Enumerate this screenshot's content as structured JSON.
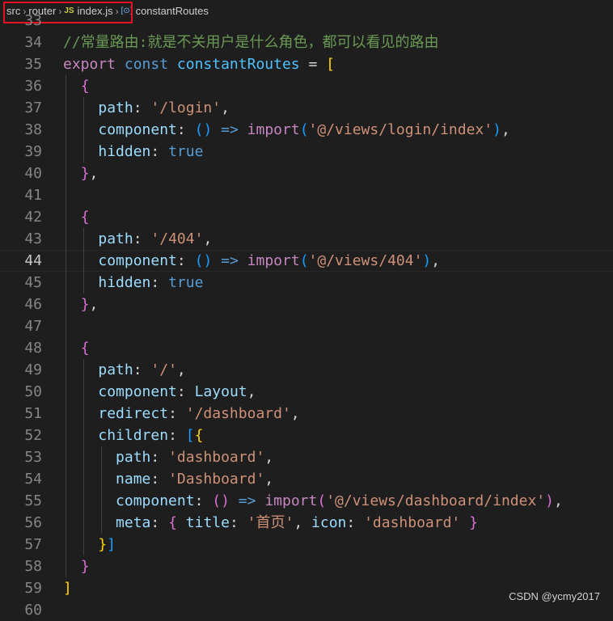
{
  "breadcrumb": {
    "items": [
      "src",
      "router",
      "index.js",
      "constantRoutes"
    ],
    "js_icon_label": "JS",
    "symbol_icon_label": "[⊙]"
  },
  "editor": {
    "active_line": 44,
    "lines": [
      {
        "n": "33",
        "text": ""
      },
      {
        "n": "34",
        "text": "//常量路由:就是不关用户是什么角色，都可以看见的路由"
      },
      {
        "n": "35",
        "text": "export const constantRoutes = ["
      },
      {
        "n": "36",
        "text": "  {"
      },
      {
        "n": "37",
        "text": "    path: '/login',"
      },
      {
        "n": "38",
        "text": "    component: () => import('@/views/login/index'),"
      },
      {
        "n": "39",
        "text": "    hidden: true"
      },
      {
        "n": "40",
        "text": "  },"
      },
      {
        "n": "41",
        "text": ""
      },
      {
        "n": "42",
        "text": "  {"
      },
      {
        "n": "43",
        "text": "    path: '/404',"
      },
      {
        "n": "44",
        "text": "    component: () => import('@/views/404'),"
      },
      {
        "n": "45",
        "text": "    hidden: true"
      },
      {
        "n": "46",
        "text": "  },"
      },
      {
        "n": "47",
        "text": ""
      },
      {
        "n": "48",
        "text": "  {"
      },
      {
        "n": "49",
        "text": "    path: '/',"
      },
      {
        "n": "50",
        "text": "    component: Layout,"
      },
      {
        "n": "51",
        "text": "    redirect: '/dashboard',"
      },
      {
        "n": "52",
        "text": "    children: [{"
      },
      {
        "n": "53",
        "text": "      path: 'dashboard',"
      },
      {
        "n": "54",
        "text": "      name: 'Dashboard',"
      },
      {
        "n": "55",
        "text": "      component: () => import('@/views/dashboard/index'),"
      },
      {
        "n": "56",
        "text": "      meta: { title: '首页', icon: 'dashboard' }"
      },
      {
        "n": "57",
        "text": "    }]"
      },
      {
        "n": "58",
        "text": "  }"
      },
      {
        "n": "59",
        "text": "]"
      },
      {
        "n": "60",
        "text": ""
      }
    ]
  },
  "watermark": "CSDN @ycmy2017"
}
